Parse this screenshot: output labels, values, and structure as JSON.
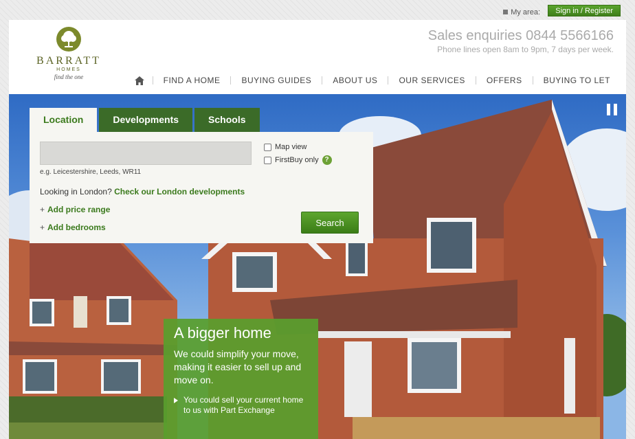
{
  "top_bar": {
    "my_area_label": "My area:",
    "sign_in_label": "Sign in / Register"
  },
  "logo": {
    "brand": "BARRATT",
    "sub": "HOMES",
    "tagline": "find the one"
  },
  "sales": {
    "headline": "Sales enquiries 0844 5566166",
    "hours": "Phone lines open 8am to 9pm, 7 days per week."
  },
  "nav": {
    "home_icon": "house-icon",
    "items": [
      "FIND A HOME",
      "BUYING GUIDES",
      "ABOUT US",
      "OUR SERVICES",
      "OFFERS",
      "BUYING TO LET"
    ]
  },
  "search": {
    "tabs": [
      "Location",
      "Developments",
      "Schools"
    ],
    "input_value": "",
    "example": "e.g. Leicestershire, Leeds, WR11",
    "map_view_label": "Map view",
    "firstbuy_label": "FirstBuy only",
    "help_glyph": "?",
    "london_prefix": "Looking in London?",
    "london_link": "Check our London developments",
    "add_price": "Add price range",
    "add_bedrooms": "Add bedrooms",
    "plus_glyph": "+",
    "search_button": "Search"
  },
  "promo": {
    "title": "A bigger home",
    "body": "We could simplify your move, making it easier to sell up and move on.",
    "bullet": "You could sell your current home to us with Part Exchange"
  },
  "colors": {
    "brand_green": "#3b7a1d",
    "tab_dark": "#3b6b28",
    "promo_green": "#599e2d",
    "logo_olive": "#7c8a2c"
  }
}
